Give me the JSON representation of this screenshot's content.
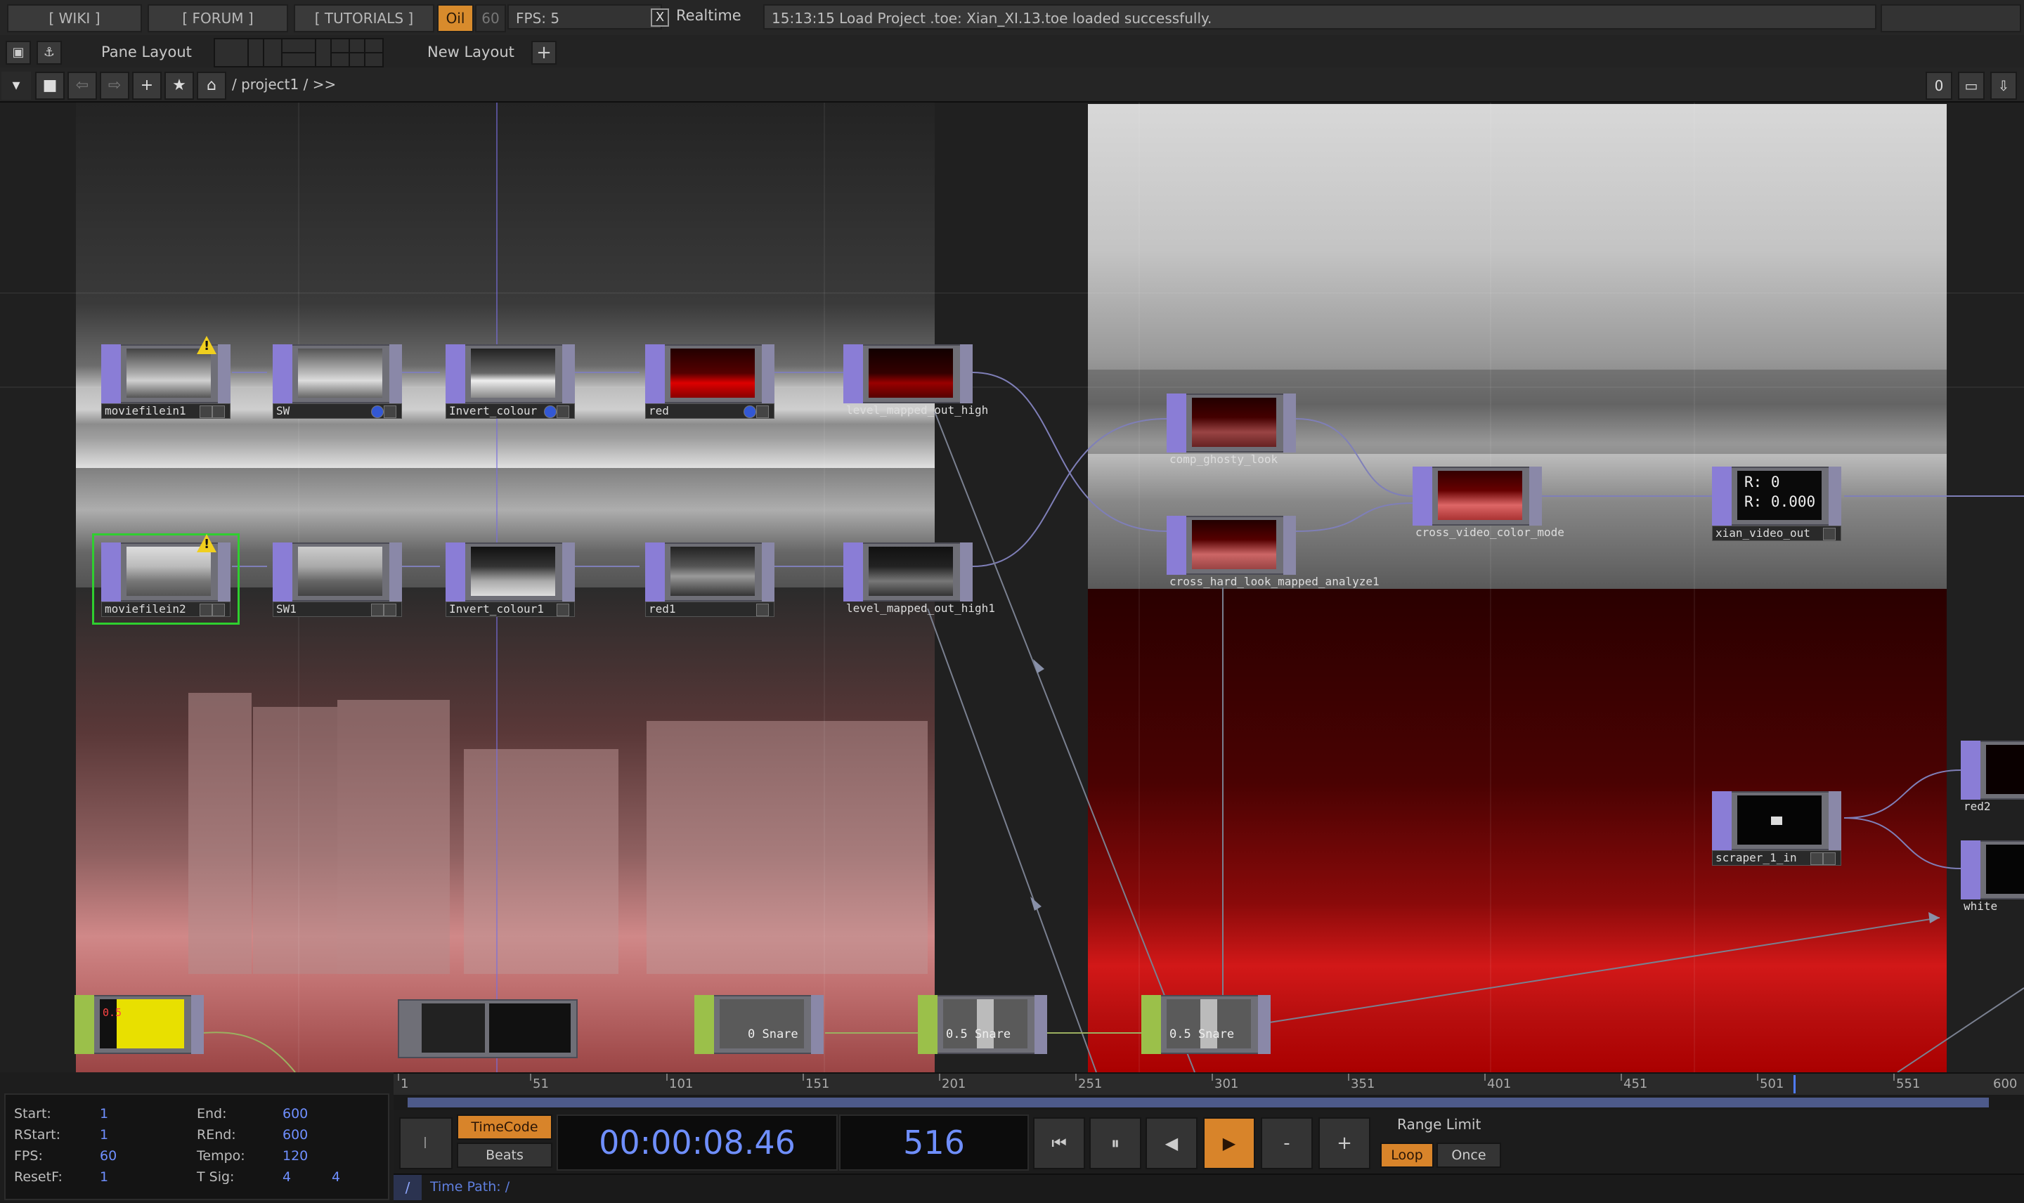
{
  "topbar": {
    "wiki": "[ WIKI ]",
    "forum": "[ FORUM ]",
    "tutorials": "[ TUTORIALS ]",
    "oil": "Oil",
    "sixty": "60",
    "fps": "FPS:  5",
    "realtime_check": "X",
    "realtime": "Realtime",
    "status": "15:13:15 Load Project .toe: Xian_XI.13.toe loaded successfully."
  },
  "panebar": {
    "pane_layout": "Pane Layout",
    "new_layout": "New Layout",
    "plus": "+"
  },
  "navbar": {
    "path": "/ project1  / >>",
    "right_num": "0"
  },
  "nodes": {
    "moviefilein1": "moviefilein1",
    "sw": "SW",
    "invert_colour": "Invert_colour",
    "red": "red",
    "level_mapped_out_high": "level_mapped_out_high",
    "moviefilein2": "moviefilein2",
    "sw1": "SW1",
    "invert_colour1": "Invert_colour1",
    "red1": "red1",
    "level_mapped_out_high1": "level_mapped_out_high1",
    "comp_ghosty_look": "comp_ghosty_look",
    "cross_hard_look": "cross_hard_look_mapped_analyze1",
    "cross_video_color_mode": "cross_video_color_mode",
    "xian_video_out": "xian_video_out",
    "scraper_1_in": "scraper_1_in",
    "red2": "red2",
    "white": "white",
    "r0": "R: 0",
    "r000": "R: 0.000",
    "snare1": "0 Snare",
    "snare2": "0.5  Snare",
    "snare3": "0.5  Snare",
    "chop_val": "0.5"
  },
  "timeline": {
    "ticks": [
      "1",
      "51",
      "101",
      "151",
      "201",
      "251",
      "301",
      "351",
      "401",
      "451",
      "501",
      "551",
      "600"
    ]
  },
  "range": {
    "start_k": "Start:",
    "start_v": "1",
    "end_k": "End:",
    "end_v": "600",
    "rstart_k": "RStart:",
    "rstart_v": "1",
    "rend_k": "REnd:",
    "rend_v": "600",
    "fps_k": "FPS:",
    "fps_v": "60",
    "tempo_k": "Tempo:",
    "tempo_v": "120",
    "resetf_k": "ResetF:",
    "resetf_v": "1",
    "tsig_k": "T Sig:",
    "tsig_v1": "4",
    "tsig_v2": "4"
  },
  "controls": {
    "timecode_btn": "TimeCode",
    "beats_btn": "Beats",
    "timecode": "00:00:08.46",
    "frame": "516",
    "minus": "-",
    "plus": "+",
    "range_limit": "Range Limit",
    "loop": "Loop",
    "once": "Once",
    "time_path": "Time Path: /",
    "slash": "/"
  },
  "colors": {
    "accent_orange": "#d8842a",
    "value_blue": "#6f8fff",
    "top_node_strip": "#8a7dd6",
    "chop_node_strip": "#9bc04a",
    "selected_outline": "#2fcf2f"
  }
}
